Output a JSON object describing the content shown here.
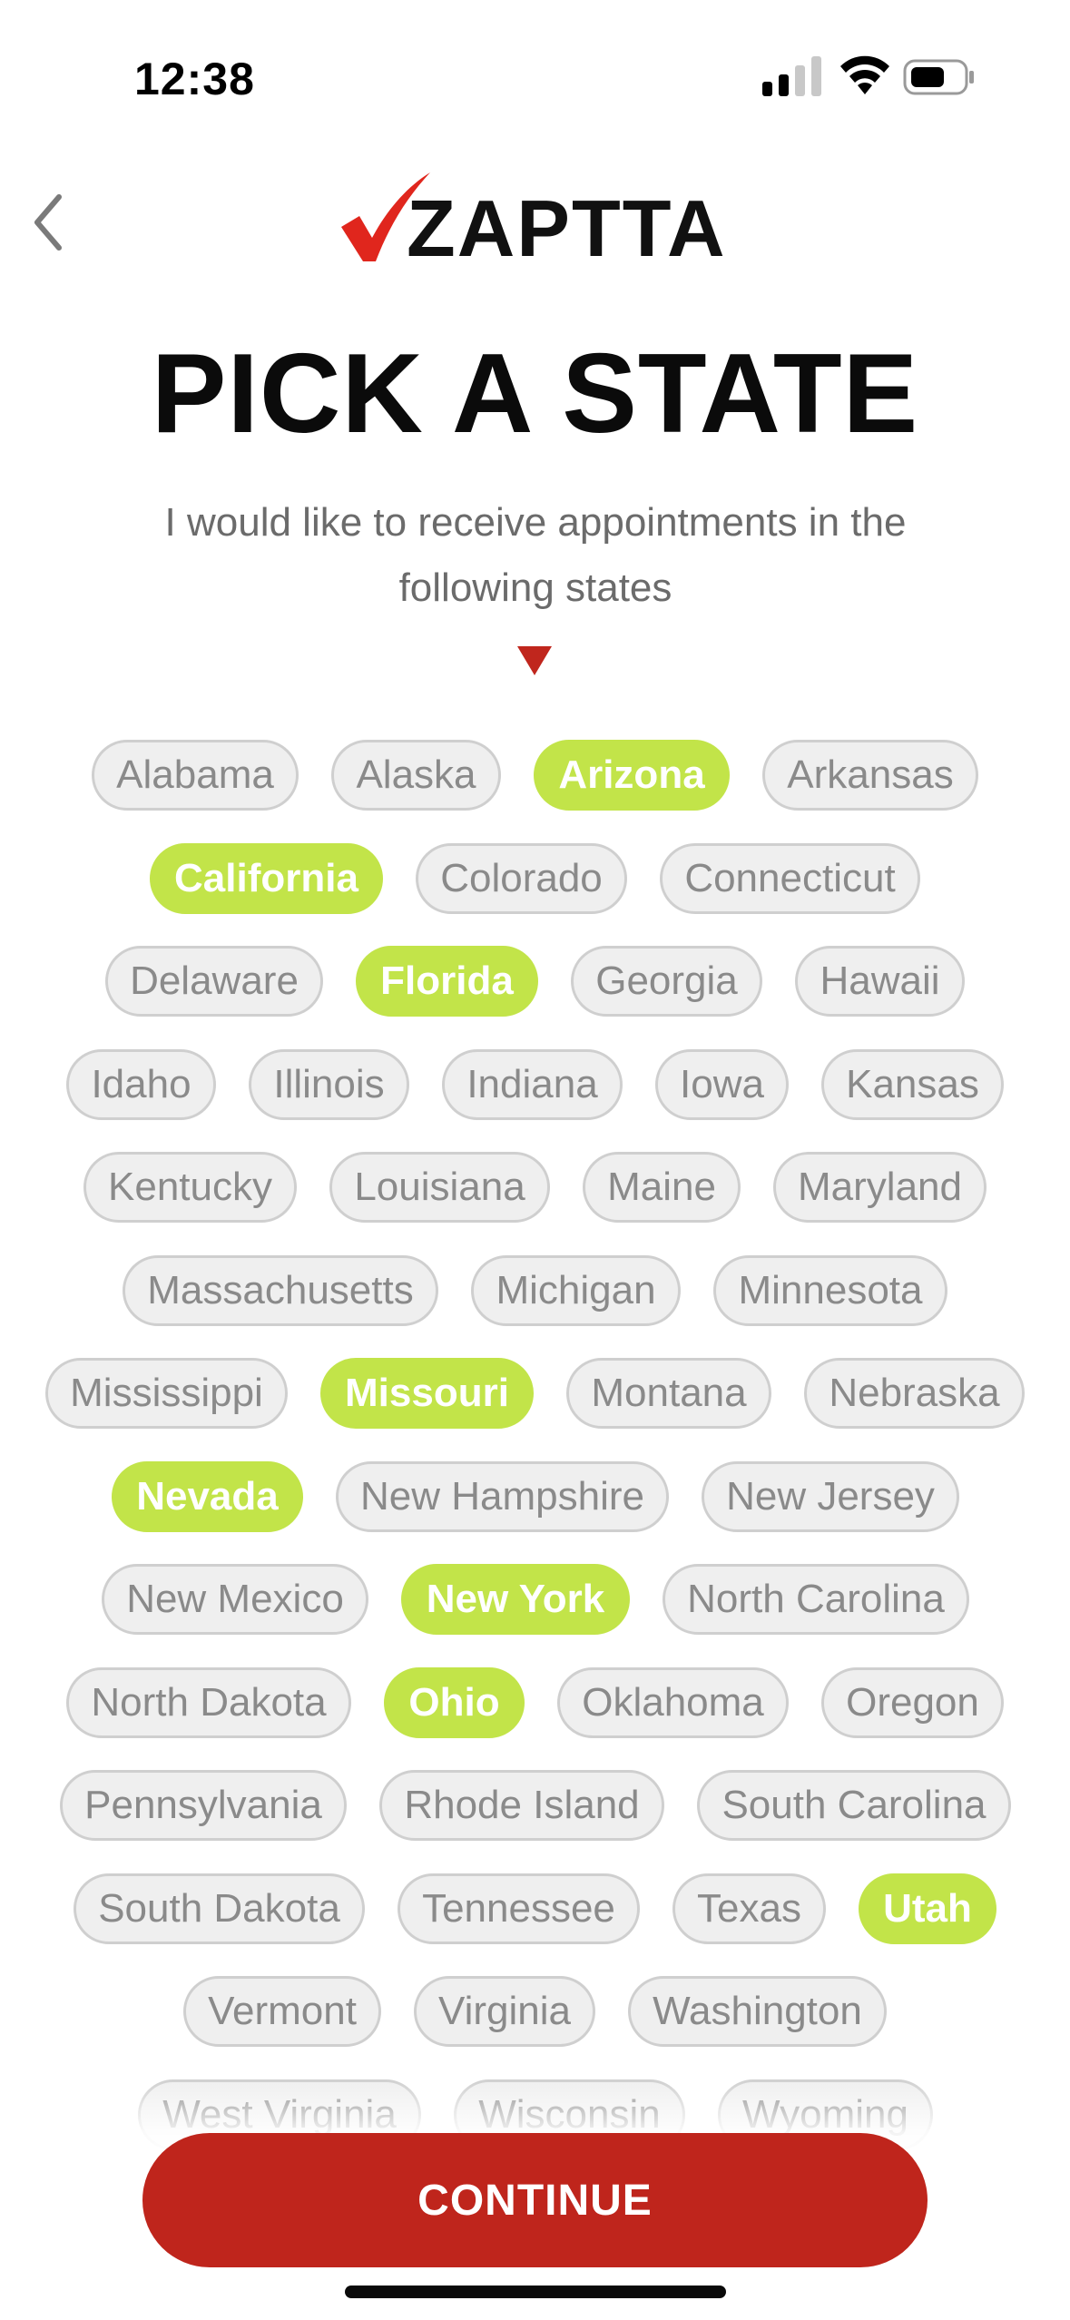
{
  "status_bar": {
    "time": "12:38",
    "signal_icon": "cellular-signal-icon",
    "wifi_icon": "wifi-icon",
    "battery_icon": "battery-icon"
  },
  "header": {
    "back_icon": "chevron-left-icon",
    "logo_text": "ZAPTTA",
    "logo_check_color": "#e0261d"
  },
  "title": "PICK A STATE",
  "subtitle": "I would like to receive appointments in the following states",
  "arrow_icon": "triangle-down-icon",
  "accent_color": "#c2e449",
  "states": [
    {
      "name": "Alabama",
      "selected": false
    },
    {
      "name": "Alaska",
      "selected": false
    },
    {
      "name": "Arizona",
      "selected": true
    },
    {
      "name": "Arkansas",
      "selected": false
    },
    {
      "name": "California",
      "selected": true
    },
    {
      "name": "Colorado",
      "selected": false
    },
    {
      "name": "Connecticut",
      "selected": false
    },
    {
      "name": "Delaware",
      "selected": false
    },
    {
      "name": "Florida",
      "selected": true
    },
    {
      "name": "Georgia",
      "selected": false
    },
    {
      "name": "Hawaii",
      "selected": false
    },
    {
      "name": "Idaho",
      "selected": false
    },
    {
      "name": "Illinois",
      "selected": false
    },
    {
      "name": "Indiana",
      "selected": false
    },
    {
      "name": "Iowa",
      "selected": false
    },
    {
      "name": "Kansas",
      "selected": false
    },
    {
      "name": "Kentucky",
      "selected": false
    },
    {
      "name": "Louisiana",
      "selected": false
    },
    {
      "name": "Maine",
      "selected": false
    },
    {
      "name": "Maryland",
      "selected": false
    },
    {
      "name": "Massachusetts",
      "selected": false
    },
    {
      "name": "Michigan",
      "selected": false
    },
    {
      "name": "Minnesota",
      "selected": false
    },
    {
      "name": "Mississippi",
      "selected": false
    },
    {
      "name": "Missouri",
      "selected": true
    },
    {
      "name": "Montana",
      "selected": false
    },
    {
      "name": "Nebraska",
      "selected": false
    },
    {
      "name": "Nevada",
      "selected": true
    },
    {
      "name": "New Hampshire",
      "selected": false
    },
    {
      "name": "New Jersey",
      "selected": false
    },
    {
      "name": "New Mexico",
      "selected": false
    },
    {
      "name": "New York",
      "selected": true
    },
    {
      "name": "North Carolina",
      "selected": false
    },
    {
      "name": "North Dakota",
      "selected": false
    },
    {
      "name": "Ohio",
      "selected": true
    },
    {
      "name": "Oklahoma",
      "selected": false
    },
    {
      "name": "Oregon",
      "selected": false
    },
    {
      "name": "Pennsylvania",
      "selected": false
    },
    {
      "name": "Rhode Island",
      "selected": false
    },
    {
      "name": "South Carolina",
      "selected": false
    },
    {
      "name": "South Dakota",
      "selected": false
    },
    {
      "name": "Tennessee",
      "selected": false
    },
    {
      "name": "Texas",
      "selected": false
    },
    {
      "name": "Utah",
      "selected": true
    },
    {
      "name": "Vermont",
      "selected": false
    },
    {
      "name": "Virginia",
      "selected": false
    },
    {
      "name": "Washington",
      "selected": false
    },
    {
      "name": "West Virginia",
      "selected": false
    },
    {
      "name": "Wisconsin",
      "selected": false
    },
    {
      "name": "Wyoming",
      "selected": false
    }
  ],
  "continue_label": "CONTINUE"
}
